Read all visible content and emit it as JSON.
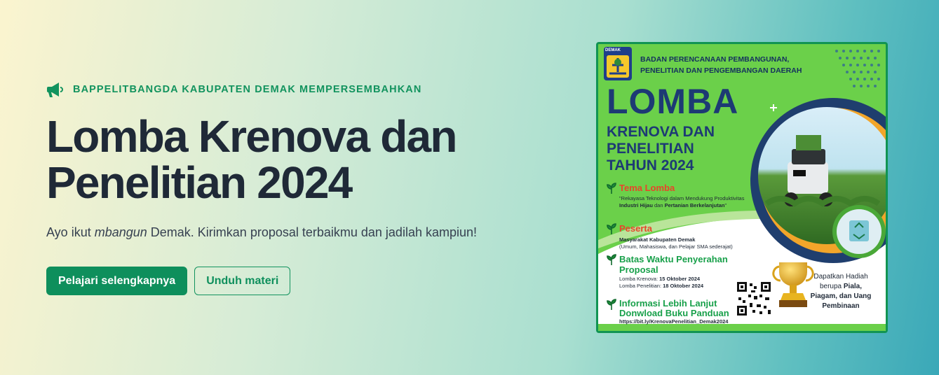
{
  "hero": {
    "eyebrow": "BAPPELITBANGDA KABUPATEN DEMAK MEMPERSEMBAHKAN",
    "eyebrow_icon": "megaphone-icon",
    "title": "Lomba Krenova dan Penelitian 2024",
    "subtitle_before": "Ayo ikut ",
    "subtitle_emph": "mbangun",
    "subtitle_after": " Demak. Kirimkan proposal terbaikmu dan jadilah kampiun!",
    "primary_button": "Pelajari selengkapnya",
    "secondary_button": "Unduh materi"
  },
  "poster": {
    "logo_text": "DEMAK",
    "org_line1": "BADAN PERENCANAAN PEMBANGUNAN,",
    "org_line2": "PENELITIAN DAN PENGEMBANGAN DAERAH",
    "headline": "LOMBA",
    "subheadline_line1": "KRENOVA DAN",
    "subheadline_line2": "PENELITIAN",
    "subheadline_line3": "TAHUN 2024",
    "tema_title": "Tema Lomba",
    "tema_desc_1": "\"Rekayasa Teknologi dalam Mendukung Produktivitas ",
    "tema_desc_bold1": "Industri Hijau",
    "tema_desc_2": " dan ",
    "tema_desc_bold2": "Pertanian Berkelanjutan",
    "tema_desc_3": "\"",
    "peserta_title": "Peserta",
    "peserta_desc_1": "Masyarakat Kabupaten Demak",
    "peserta_desc_2": "(Umum, Mahasiswa, dan Pelajar SMA sederajat)",
    "batas_title": "Batas Waktu Penyerahan Proposal",
    "batas_krenova_label": "Lomba Krenova: ",
    "batas_krenova_date": "15 Oktober 2024",
    "batas_penelitian_label": "Lomba Penelitian: ",
    "batas_penelitian_date": "18 Oktober 2024",
    "info_title": "Informasi Lebih Lanjut Donwload Buku Panduan",
    "link": "https://bit.ly/KrenovaPenelitian_Demak2024",
    "hadiah_1": "Dapatkan Hadiah berupa ",
    "hadiah_bold": "Piala, Piagam, dan Uang Pembinaan",
    "colors": {
      "accent": "#0e8f5c",
      "poster_green": "#6bd04a",
      "poster_navy": "#1d3a74",
      "section_red": "#e8452a"
    }
  }
}
